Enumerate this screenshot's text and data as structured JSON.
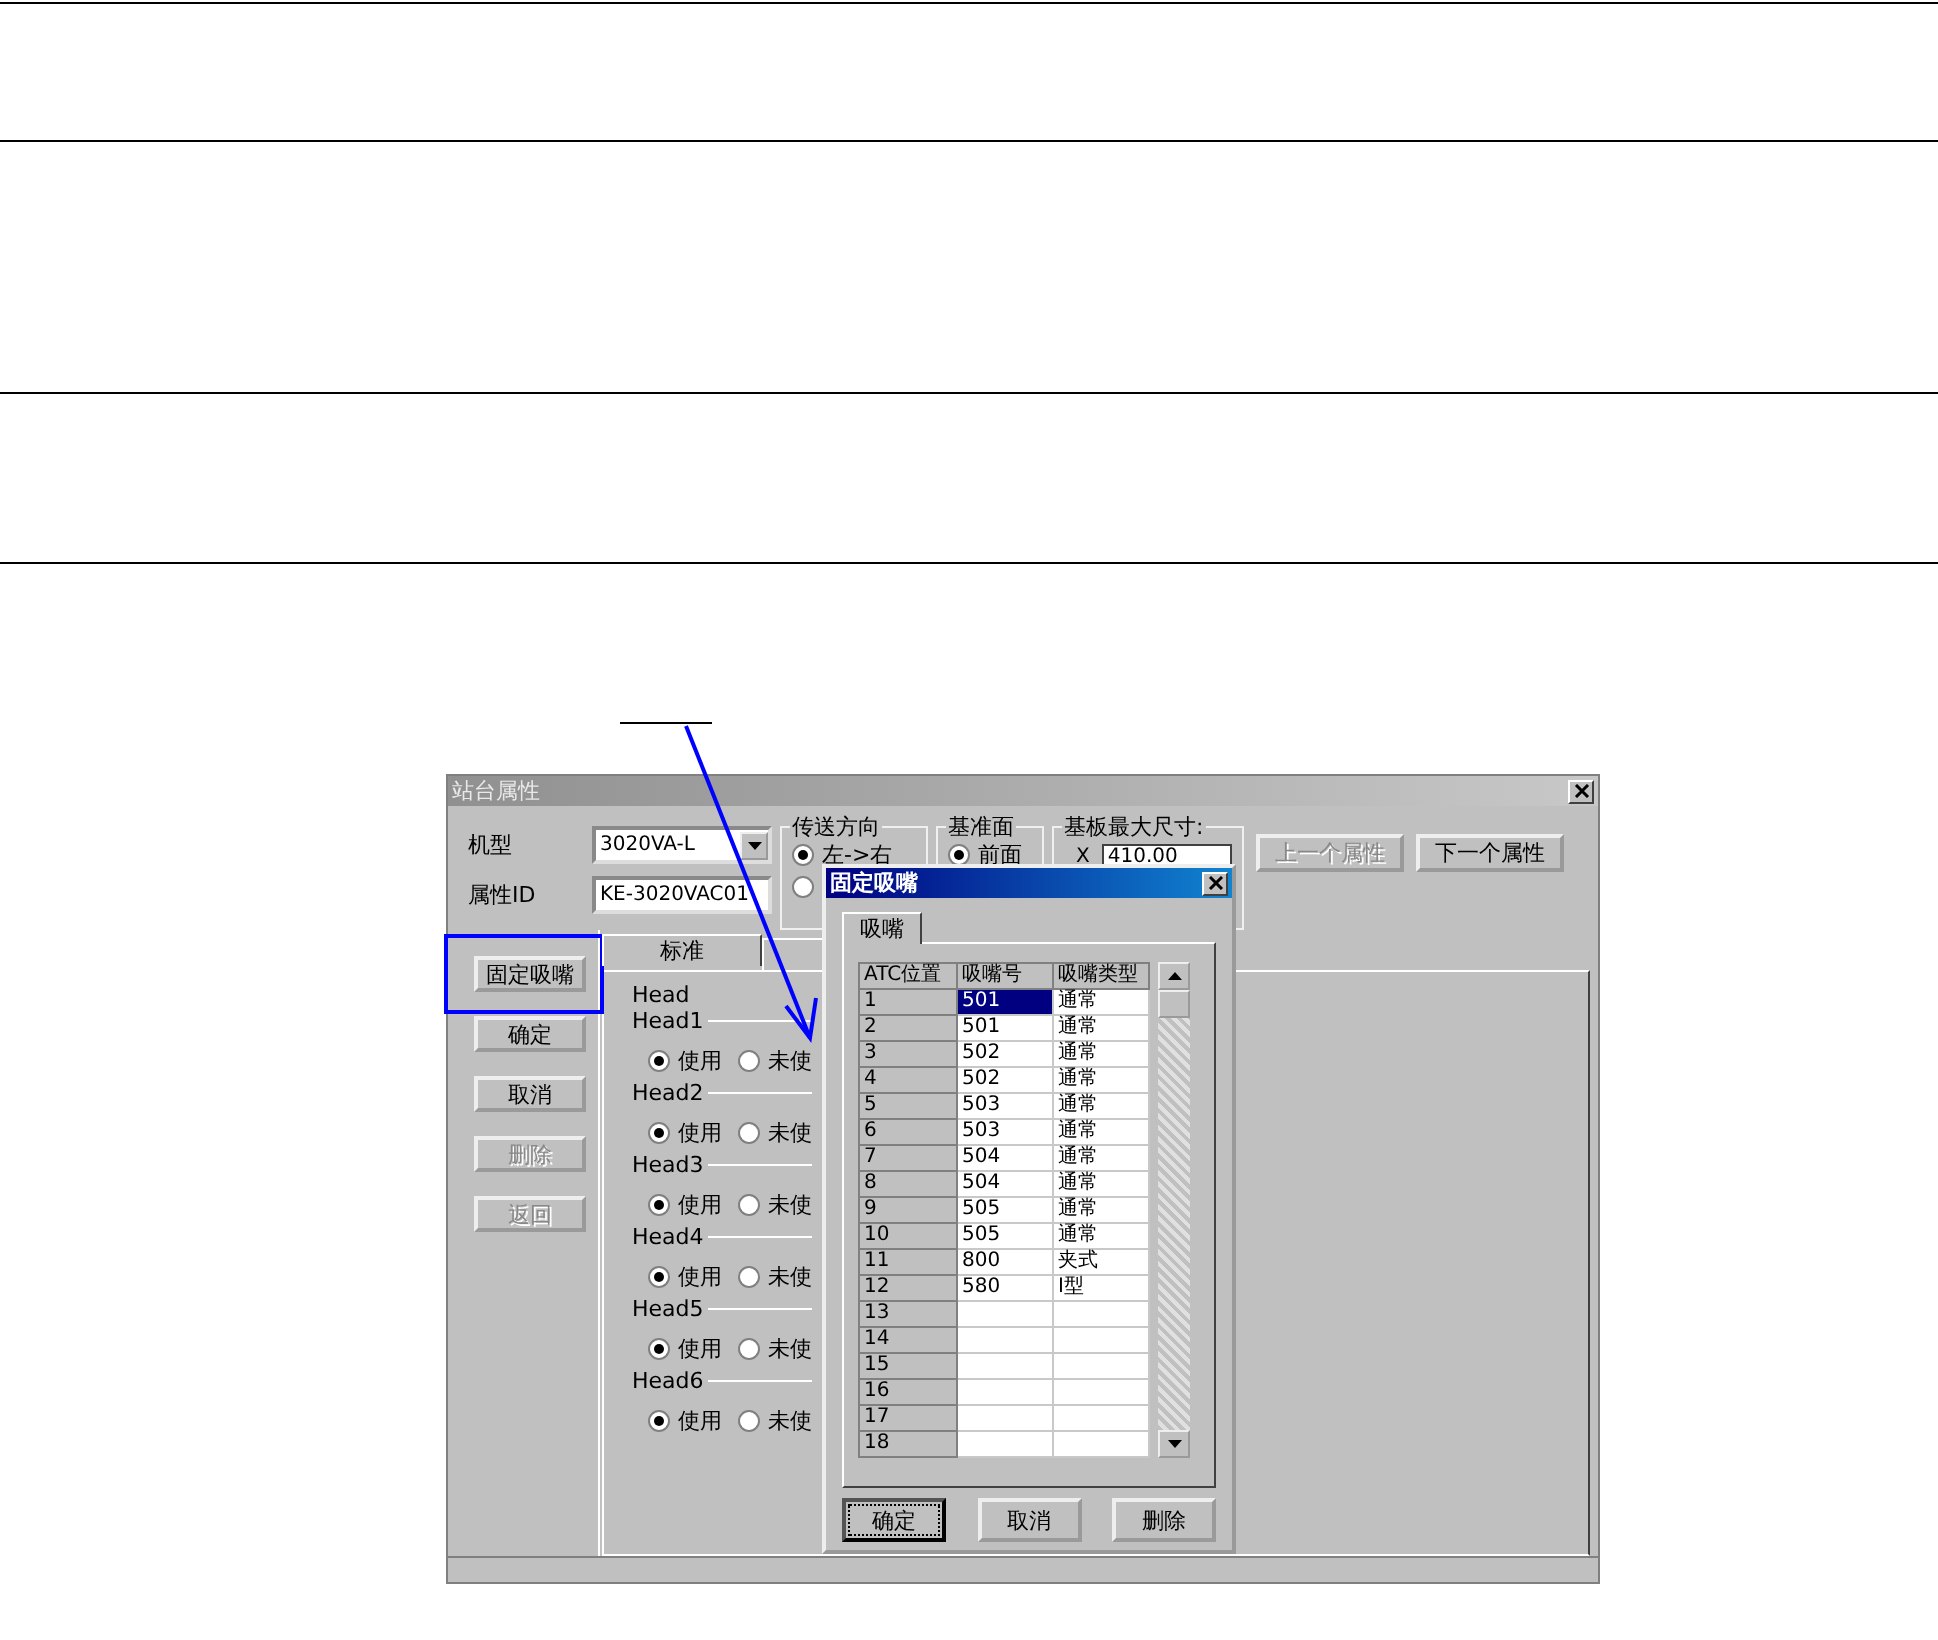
{
  "window": {
    "title": "站台属性"
  },
  "fields": [
    {
      "label": "机型",
      "value": "3020VA-L",
      "kind": "combo"
    },
    {
      "label": "属性ID",
      "value": "KE-3020VAC01",
      "kind": "text"
    }
  ],
  "groups": [
    {
      "title": "传送方向",
      "options": [
        {
          "label": "左->右",
          "selected": true
        },
        {
          "selected": false
        }
      ]
    },
    {
      "title": "基准面",
      "options": [
        {
          "label": "前面",
          "selected": true
        }
      ]
    },
    {
      "title": "基板最大尺寸:",
      "size": {
        "label": "X",
        "value": "410.00"
      }
    }
  ],
  "nav_buttons": [
    {
      "label": "上一个属性",
      "disabled": true
    },
    {
      "label": "下一个属性",
      "disabled": false
    }
  ],
  "side_buttons": [
    {
      "label": "固定吸嘴",
      "disabled": false
    },
    {
      "label": "确定",
      "disabled": false
    },
    {
      "label": "取消",
      "disabled": false
    },
    {
      "label": "删除",
      "disabled": true
    },
    {
      "label": "返回",
      "disabled": true
    }
  ],
  "tabs": [
    {
      "label": "标准",
      "selected": true
    },
    {
      "selected": false
    }
  ],
  "head_group": {
    "title": "Head",
    "heads": [
      {
        "label": "Head1",
        "options": [
          {
            "label": "使用",
            "selected": true
          },
          {
            "label": "未使",
            "selected": false
          }
        ]
      },
      {
        "label": "Head2",
        "options": [
          {
            "label": "使用",
            "selected": true
          },
          {
            "label": "未使",
            "selected": false
          }
        ]
      },
      {
        "label": "Head3",
        "options": [
          {
            "label": "使用",
            "selected": true
          },
          {
            "label": "未使",
            "selected": false
          }
        ]
      },
      {
        "label": "Head4",
        "options": [
          {
            "label": "使用",
            "selected": true
          },
          {
            "label": "未使",
            "selected": false
          }
        ]
      },
      {
        "label": "Head5",
        "options": [
          {
            "label": "使用",
            "selected": true
          },
          {
            "label": "未使",
            "selected": false
          }
        ]
      },
      {
        "label": "Head6",
        "options": [
          {
            "label": "使用",
            "selected": true
          },
          {
            "label": "未使",
            "selected": false
          }
        ]
      }
    ]
  },
  "dialog": {
    "title": "固定吸嘴",
    "tabs": [
      {
        "label": "吸嘴",
        "selected": true
      }
    ],
    "table": {
      "columns": [
        "ATC位置",
        "吸嘴号",
        "吸嘴类型"
      ],
      "rows": [
        {
          "cells": [
            "1",
            "501",
            "通常"
          ],
          "selected": true
        },
        {
          "cells": [
            "2",
            "501",
            "通常"
          ],
          "selected": false
        },
        {
          "cells": [
            "3",
            "502",
            "通常"
          ],
          "selected": false
        },
        {
          "cells": [
            "4",
            "502",
            "通常"
          ],
          "selected": false
        },
        {
          "cells": [
            "5",
            "503",
            "通常"
          ],
          "selected": false
        },
        {
          "cells": [
            "6",
            "503",
            "通常"
          ],
          "selected": false
        },
        {
          "cells": [
            "7",
            "504",
            "通常"
          ],
          "selected": false
        },
        {
          "cells": [
            "8",
            "504",
            "通常"
          ],
          "selected": false
        },
        {
          "cells": [
            "9",
            "505",
            "通常"
          ],
          "selected": false
        },
        {
          "cells": [
            "10",
            "505",
            "通常"
          ],
          "selected": false
        },
        {
          "cells": [
            "11",
            "800",
            "夹式"
          ],
          "selected": false
        },
        {
          "cells": [
            "12",
            "580",
            "I型"
          ],
          "selected": false
        },
        {
          "cells": [
            "13",
            "",
            ""
          ],
          "selected": false
        },
        {
          "cells": [
            "14",
            "",
            ""
          ],
          "selected": false
        },
        {
          "cells": [
            "15",
            "",
            ""
          ],
          "selected": false
        },
        {
          "cells": [
            "16",
            "",
            ""
          ],
          "selected": false
        },
        {
          "cells": [
            "17",
            "",
            ""
          ],
          "selected": false
        },
        {
          "cells": [
            "18",
            "",
            ""
          ],
          "selected": false
        }
      ]
    },
    "buttons": [
      {
        "label": "确定",
        "focused": true
      },
      {
        "label": "取消",
        "focused": false
      },
      {
        "label": "删除",
        "focused": false
      }
    ]
  }
}
